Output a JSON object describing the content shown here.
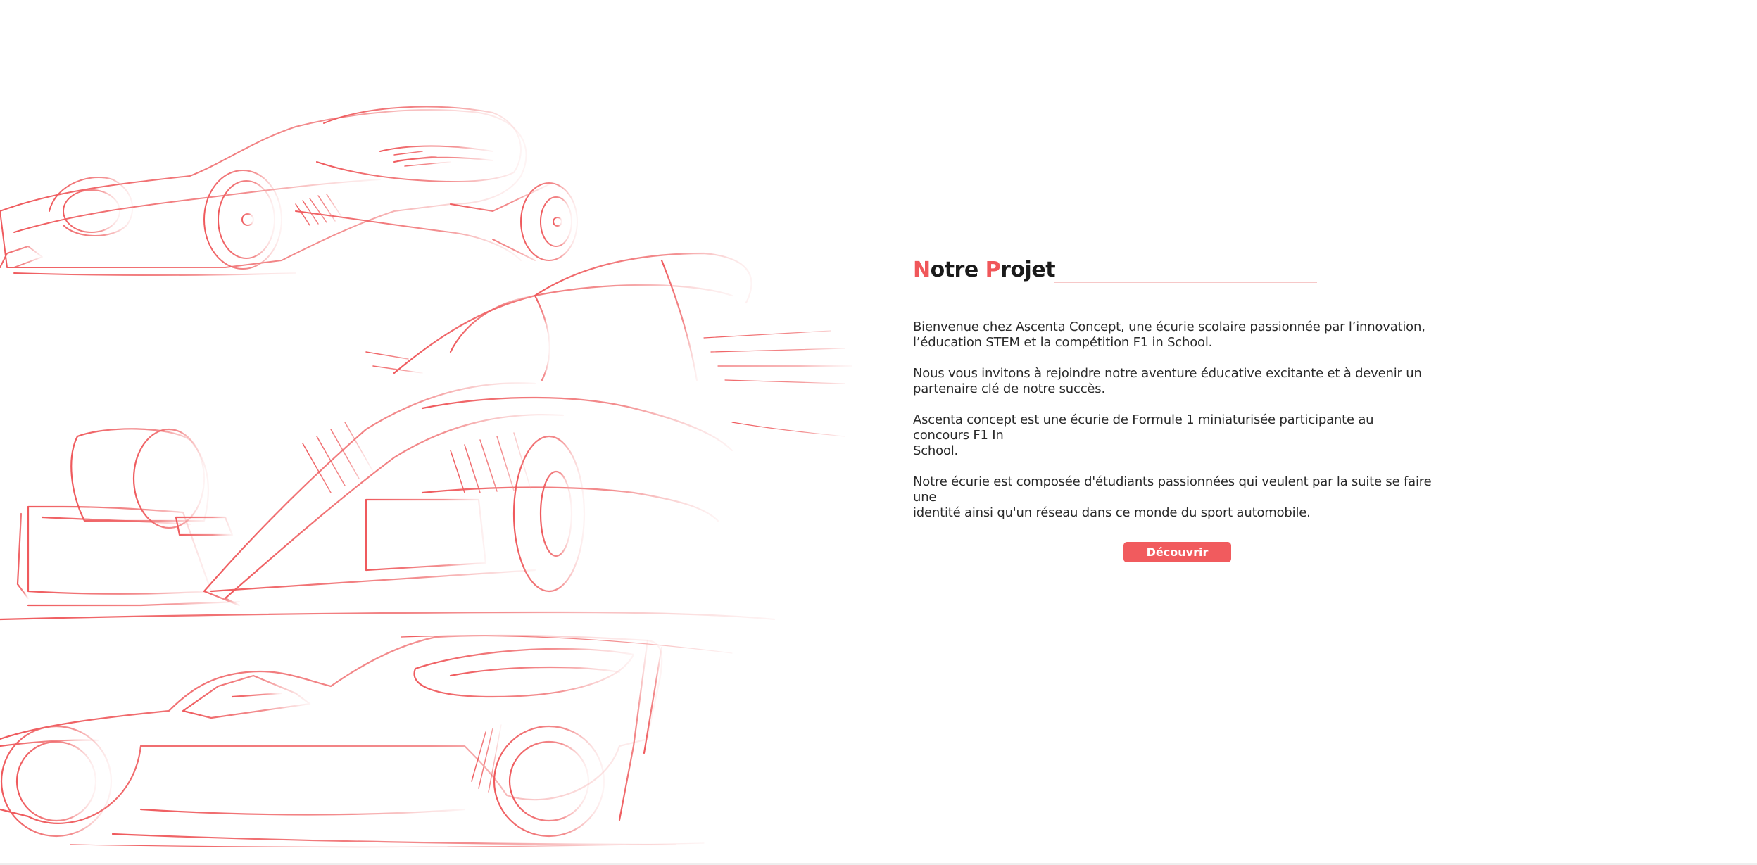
{
  "section": {
    "title_parts": [
      {
        "text": "N",
        "accent": true
      },
      {
        "text": "otre ",
        "accent": false
      },
      {
        "text": "P",
        "accent": true
      },
      {
        "text": "rojet",
        "accent": false
      }
    ],
    "paragraphs": [
      {
        "lines": [
          "Bienvenue chez Ascenta Concept, une écurie scolaire passionnée par l’innovation,",
          "l’éducation STEM et la compétition F1 in School."
        ]
      },
      {
        "lines": [
          "Nous vous invitons à rejoindre notre aventure éducative excitante et à devenir un",
          "partenaire clé de notre succès."
        ]
      },
      {
        "lines": [
          "Ascenta concept est une écurie de Formule 1 miniaturisée participante au",
          "concours F1 In",
          "School."
        ]
      },
      {
        "lines": [
          "Notre écurie est composée d'étudiants passionnées qui veulent par la suite se faire",
          "une",
          "identité ainsi qu'un réseau dans ce monde du sport automobile."
        ]
      }
    ],
    "button_label": "Découvrir"
  },
  "colors": {
    "accent": "#f0575a",
    "button": "#f15b5e",
    "sketch": "#f06a6c",
    "text": "#2a2a2a"
  },
  "illustration": {
    "icon": "f1-car-sketches"
  }
}
